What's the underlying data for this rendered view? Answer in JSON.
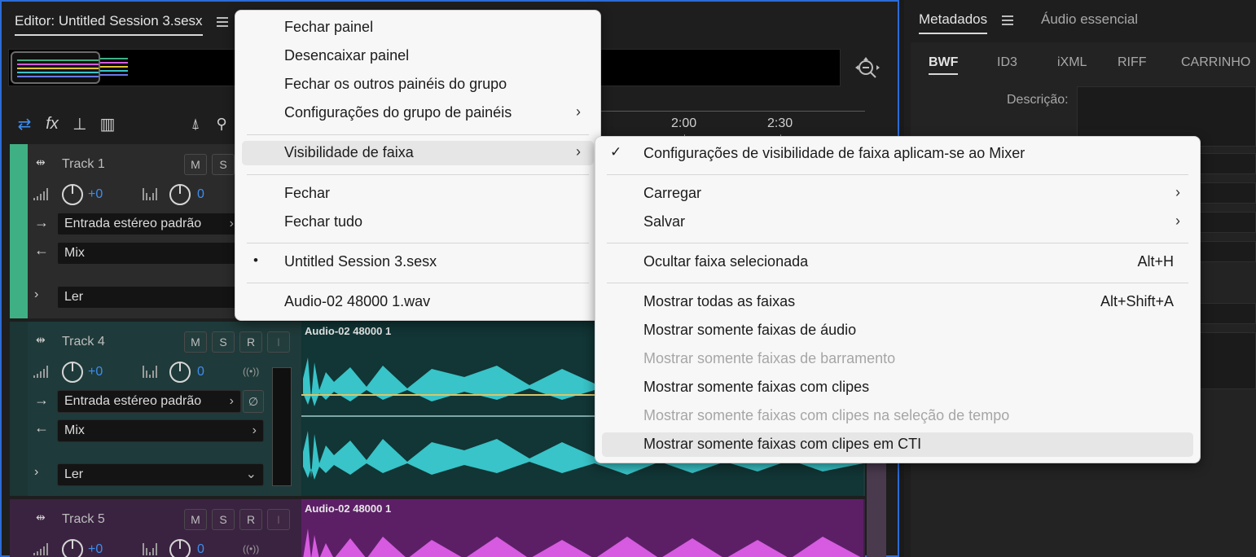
{
  "editor": {
    "title": "Editor: Untitled Session 3.sesx",
    "ruler": {
      "ticks": [
        "2:00",
        "2:30"
      ]
    }
  },
  "tracks": [
    {
      "name": "Track 1",
      "buttons": [
        "M",
        "S"
      ],
      "volume": "+0",
      "pan": "0",
      "input": "Entrada estéreo padrão",
      "output": "Mix",
      "automation": "Ler",
      "color": "#3fb083"
    },
    {
      "name": "Track 4",
      "buttons": [
        "M",
        "S",
        "R",
        "I"
      ],
      "volume": "+0",
      "pan": "0",
      "input": "Entrada estéreo padrão",
      "output": "Mix",
      "automation": "Ler",
      "color": "#1f4a4a",
      "clip_title": "Audio-02 48000 1",
      "wave_color": "#38c4c8"
    },
    {
      "name": "Track 5",
      "buttons": [
        "M",
        "S",
        "R",
        "I"
      ],
      "volume": "+0",
      "pan": "0",
      "color": "#5a2b63",
      "clip_title": "Audio-02 48000 1",
      "wave_color": "#d65be0"
    }
  ],
  "right_panel": {
    "tabs": [
      "Metadados",
      "Áudio essencial"
    ],
    "subtabs": [
      "BWF",
      "ID3",
      "iXML",
      "RIFF",
      "CARRINHO"
    ],
    "description_label": "Descrição:"
  },
  "panel_menu": {
    "items": [
      {
        "label": "Fechar painel"
      },
      {
        "label": "Desencaixar painel"
      },
      {
        "label": "Fechar os outros painéis do grupo"
      },
      {
        "label": "Configurações do grupo de painéis",
        "submenu": "›"
      },
      {
        "label": "Visibilidade de faixa",
        "submenu": "›",
        "highlighted": true
      },
      {
        "label": "Fechar"
      },
      {
        "label": "Fechar tudo"
      },
      {
        "label": "Untitled Session 3.sesx",
        "mark": "•"
      },
      {
        "label": "Audio-02 48000 1.wav"
      }
    ]
  },
  "visibility_menu": {
    "items": [
      {
        "label": "Configurações de visibilidade de faixa aplicam-se ao Mixer",
        "mark": "✓"
      },
      {
        "label": "Carregar",
        "submenu": "›"
      },
      {
        "label": "Salvar",
        "submenu": "›"
      },
      {
        "label": "Ocultar faixa selecionada",
        "shortcut": "Alt+H"
      },
      {
        "label": "Mostrar todas as faixas",
        "shortcut": "Alt+Shift+A"
      },
      {
        "label": "Mostrar somente faixas de áudio"
      },
      {
        "label": "Mostrar somente faixas de barramento",
        "disabled": true
      },
      {
        "label": "Mostrar somente faixas com clipes"
      },
      {
        "label": "Mostrar somente faixas com clipes na seleção de tempo",
        "disabled": true
      },
      {
        "label": "Mostrar somente faixas com clipes em CTI",
        "highlighted": true
      }
    ]
  }
}
